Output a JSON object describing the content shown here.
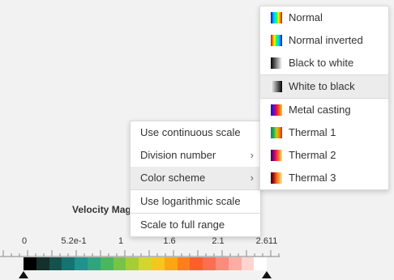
{
  "legend": {
    "title": "Velocity Mag",
    "ticks": [
      "0",
      "5.2e-1",
      "1",
      "1.6",
      "2.1",
      "2.611"
    ],
    "min_value": 0,
    "max_value": 2.611,
    "colors": [
      "#000000",
      "#13302d",
      "#15524e",
      "#187270",
      "#1f928d",
      "#2ea57f",
      "#4cb560",
      "#78c24a",
      "#a6cd35",
      "#d4d62b",
      "#f4c81b",
      "#fba712",
      "#fd7e1a",
      "#fc5f2d",
      "#fb6d55",
      "#fb8b7c",
      "#fcada4",
      "#fdd4cf",
      "#ffffff"
    ]
  },
  "context_menu": {
    "items": [
      {
        "label": "Use continuous scale",
        "submenu": false
      },
      {
        "label": "Division number",
        "submenu": true
      },
      {
        "label": "Color scheme",
        "submenu": true,
        "highlighted": true
      },
      {
        "label": "Use logarithmic scale",
        "submenu": false
      },
      {
        "label": "Scale to full range",
        "submenu": false
      }
    ],
    "chevron": "›"
  },
  "color_scheme_menu": {
    "items": [
      {
        "label": "Normal",
        "icon": "normal-gradient-icon"
      },
      {
        "label": "Normal inverted",
        "icon": "normal-inverted-gradient-icon"
      },
      {
        "label": "Black to white",
        "icon": "black-to-white-gradient-icon"
      },
      {
        "label": "White to black",
        "icon": "white-to-black-gradient-icon",
        "highlighted": true
      },
      {
        "label": "Metal casting",
        "icon": "metal-casting-gradient-icon"
      },
      {
        "label": "Thermal 1",
        "icon": "thermal-1-gradient-icon"
      },
      {
        "label": "Thermal 2",
        "icon": "thermal-2-gradient-icon"
      },
      {
        "label": "Thermal 3",
        "icon": "thermal-3-gradient-icon"
      }
    ]
  }
}
